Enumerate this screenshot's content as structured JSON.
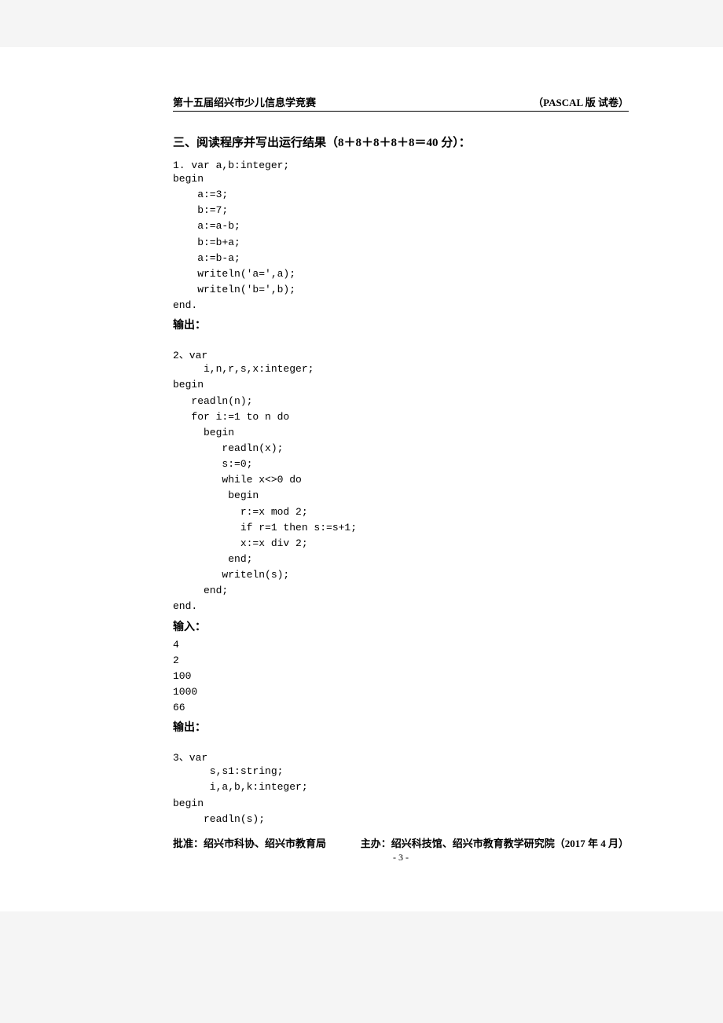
{
  "header": {
    "left": "第十五届绍兴市少儿信息学竞赛",
    "right": "（PASCAL 版 试卷）"
  },
  "section_title": "三、阅读程序并写出运行结果（8＋8＋8＋8＋8＝40 分）：",
  "q1": {
    "label": "1. var a,b:integer;",
    "code": "begin\n    a:=3;\n    b:=7;\n    a:=a-b;\n    b:=b+a;\n    a:=b-a;\n    writeln('a=',a);\n    writeln('b=',b);\nend.",
    "output_label": "输出："
  },
  "q2": {
    "label": "2、var",
    "code": "     i,n,r,s,x:integer;\nbegin\n   readln(n);\n   for i:=1 to n do\n     begin\n        readln(x);\n        s:=0;\n        while x<>0 do\n         begin\n           r:=x mod 2;\n           if r=1 then s:=s+1;\n           x:=x div 2;\n         end;\n        writeln(s);\n     end;\nend.",
    "input_label": "输入：",
    "input_values": "4\n2\n100\n1000\n66",
    "output_label": "输出："
  },
  "q3": {
    "label": "3、var",
    "code": "      s,s1:string;\n      i,a,b,k:integer;\nbegin\n     readln(s);"
  },
  "footer": {
    "left": "批准：绍兴市科协、绍兴市教育局",
    "right": "主办：绍兴科技馆、绍兴市教育教学研究院（2017 年 4 月）",
    "page": "- 3 -"
  }
}
